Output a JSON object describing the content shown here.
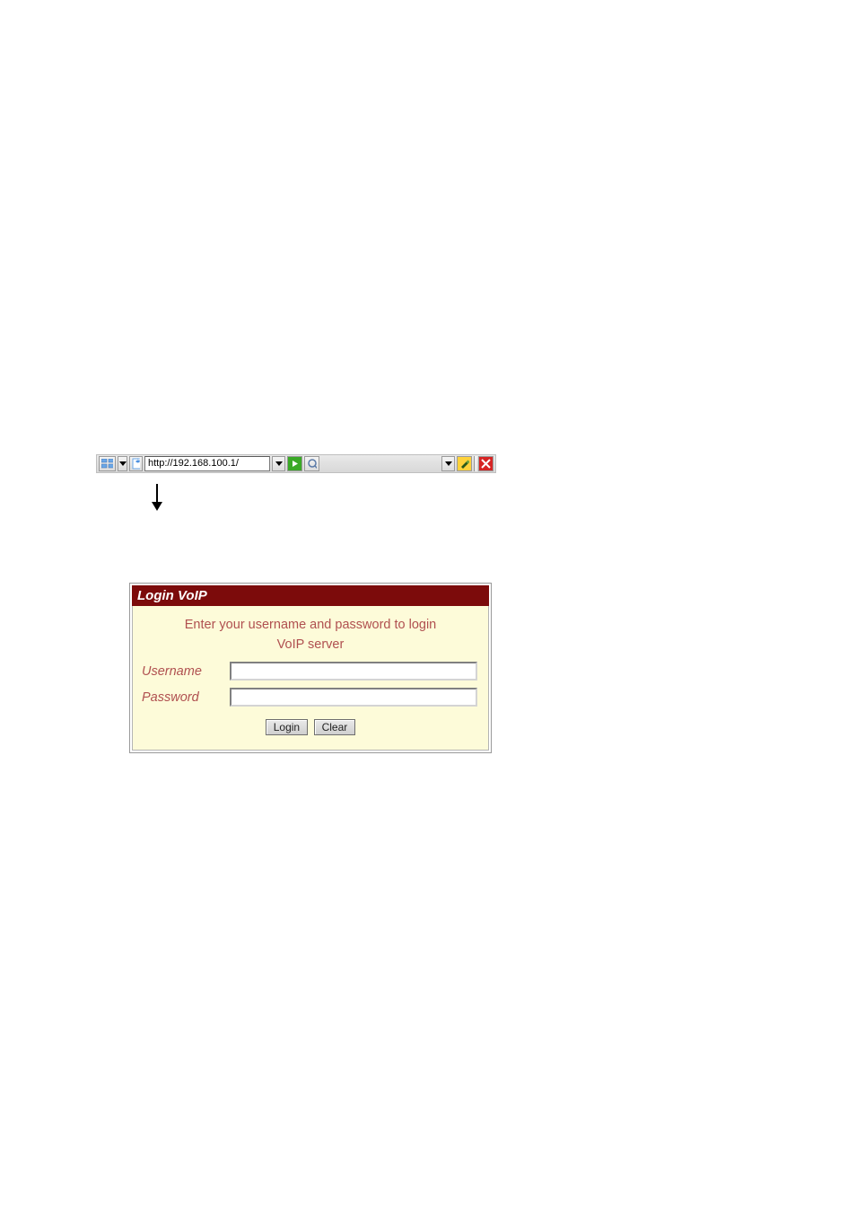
{
  "toolbar": {
    "url": "http://192.168.100.1/"
  },
  "login": {
    "title": "Login VoIP",
    "message_line1": "Enter your username and password to login",
    "message_line2": "VoIP server",
    "username_label": "Username",
    "password_label": "Password",
    "login_btn": "Login",
    "clear_btn": "Clear"
  }
}
